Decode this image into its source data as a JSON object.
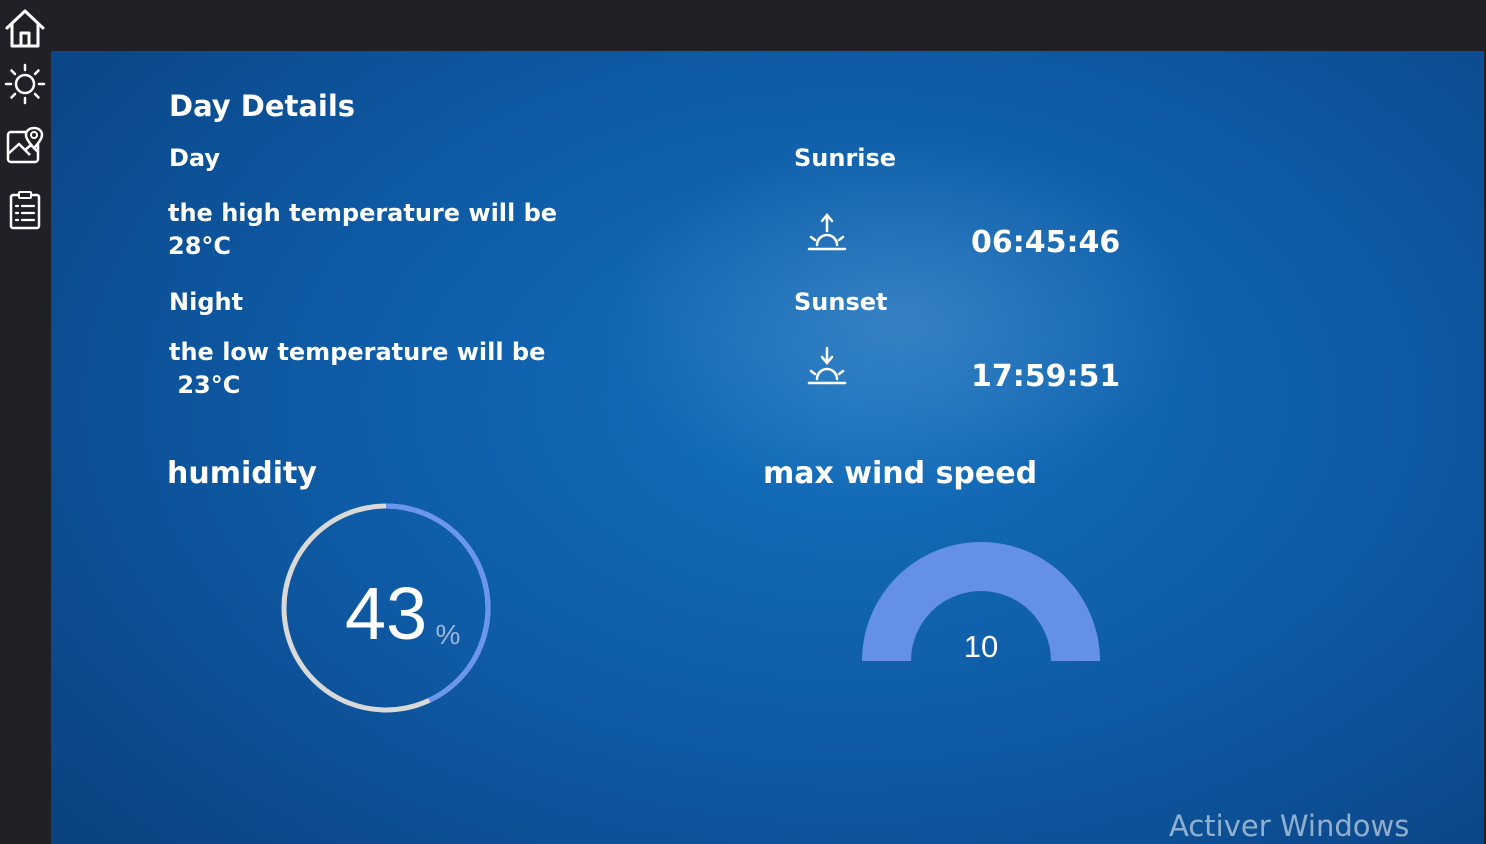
{
  "sidebar": {
    "items": [
      {
        "icon": "home-icon"
      },
      {
        "icon": "sun-icon"
      },
      {
        "icon": "map-icon"
      },
      {
        "icon": "clipboard-list-icon"
      }
    ]
  },
  "details": {
    "title": "Day Details",
    "day": {
      "label": "Day",
      "text": "the high temperature will be\n28°C"
    },
    "night": {
      "label": "Night",
      "text": "the low temperature will be\n 23°C"
    },
    "sunrise": {
      "label": "Sunrise",
      "time": "06:45:46",
      "icon": "sunrise-icon"
    },
    "sunset": {
      "label": "Sunset",
      "time": "17:59:51",
      "icon": "sunset-icon"
    }
  },
  "humidity": {
    "title": "humidity",
    "value": "43",
    "unit": "%",
    "ring_color": "#6a96ee",
    "track_color": "#d9d9d9"
  },
  "wind": {
    "title": "max wind speed",
    "value": "10",
    "arc_color": "#6590e9"
  },
  "watermark": "Activer Windows"
}
